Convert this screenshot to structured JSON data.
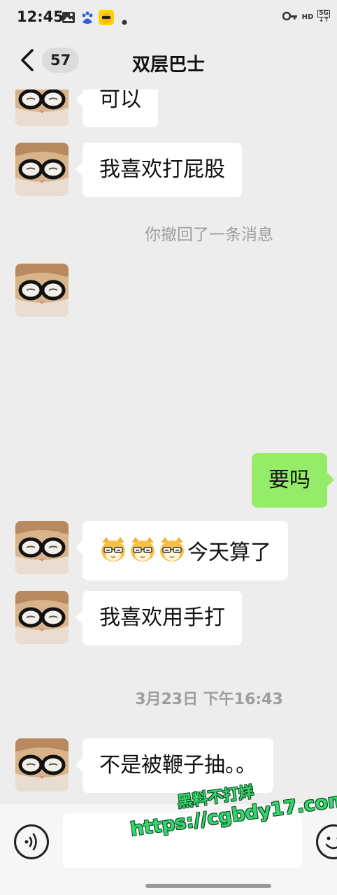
{
  "status_bar": {
    "time": "12:45",
    "hd": "HD",
    "network": "5G",
    "icons": [
      "gallery-icon",
      "baidu-app-icon",
      "meituan-app-icon",
      "dot-icon",
      "key-icon",
      "signal-icon"
    ]
  },
  "header": {
    "unread_count": "57",
    "title": "双层巴士"
  },
  "messages": [
    {
      "type": "incoming",
      "text": "可以"
    },
    {
      "type": "incoming",
      "text": "我喜欢打屁股"
    },
    {
      "type": "system",
      "text": "你撤回了一条消息"
    },
    {
      "type": "incoming",
      "text": ""
    },
    {
      "type": "outgoing",
      "text": "要吗"
    },
    {
      "type": "incoming",
      "text": "今天算了",
      "emoji_prefix": [
        "cat-face-emoji",
        "cat-face-emoji",
        "cat-face-emoji"
      ]
    },
    {
      "type": "incoming",
      "text": "我喜欢用手打"
    },
    {
      "type": "timestamp",
      "text": "3月23日 下午16:43"
    },
    {
      "type": "incoming",
      "text": "不是被鞭子抽。。"
    }
  ],
  "input_bar": {
    "placeholder": "",
    "left_button": "voice-icon",
    "right_button": "emoji-icon"
  },
  "watermark": {
    "line1": "黑料不打烊",
    "line2": "https://cgbdy17.com"
  },
  "colors": {
    "background": "#ededed",
    "incoming_bubble": "#ffffff",
    "outgoing_bubble": "#95ec69",
    "system_text": "#9e9e9e",
    "watermark": "#36d36e"
  }
}
